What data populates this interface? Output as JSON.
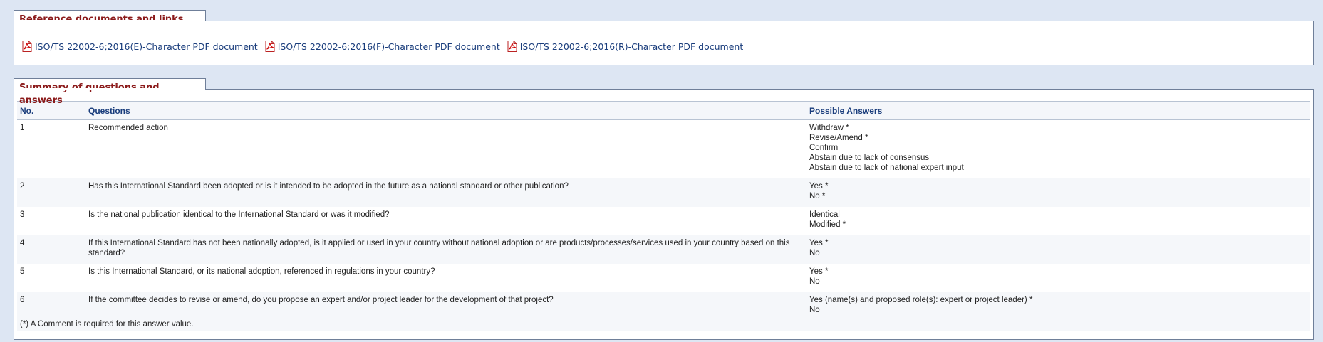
{
  "reference": {
    "title": "Reference documents and links",
    "documents": [
      {
        "label": "ISO/TS 22002-6;2016(E)-Character PDF document",
        "icon": "pdf-icon"
      },
      {
        "label": "ISO/TS 22002-6;2016(F)-Character PDF document",
        "icon": "pdf-icon"
      },
      {
        "label": "ISO/TS 22002-6;2016(R)-Character PDF document",
        "icon": "pdf-icon"
      }
    ]
  },
  "summary": {
    "title": "Summary of questions and answers",
    "headers": {
      "no": "No.",
      "questions": "Questions",
      "answers": "Possible Answers"
    },
    "rows": [
      {
        "no": "1",
        "question": "Recommended action",
        "answers": [
          "Withdraw  *",
          "Revise/Amend  *",
          "Confirm",
          "Abstain due to lack of consensus",
          "Abstain due to lack of national expert input"
        ]
      },
      {
        "no": "2",
        "question": "Has this International Standard been adopted or is it intended to be adopted in the future as a national standard or other publication?",
        "answers": [
          "Yes  *",
          "No  *"
        ]
      },
      {
        "no": "3",
        "question": "Is the national publication identical to the International Standard or was it modified?",
        "answers": [
          "Identical",
          "Modified  *"
        ]
      },
      {
        "no": "4",
        "question": "If this International Standard has not been nationally adopted, is it applied or used in your country without national adoption or are products/processes/services used in your country based on this standard?",
        "answers": [
          "Yes  *",
          "No"
        ]
      },
      {
        "no": "5",
        "question": "Is this International Standard, or its national adoption, referenced in regulations in your country?",
        "answers": [
          "Yes  *",
          "No"
        ]
      },
      {
        "no": "6",
        "question": "If the committee decides to revise or amend, do you propose an expert and/or project leader for the development of that project?",
        "answers": [
          "Yes (name(s) and proposed role(s): expert or project leader)  *",
          "No"
        ]
      }
    ],
    "footnote": "(*) A Comment is required for this answer value."
  },
  "colors": {
    "accent_title": "#8b1a1a",
    "link": "#1a3d7c",
    "background": "#dde6f3"
  }
}
